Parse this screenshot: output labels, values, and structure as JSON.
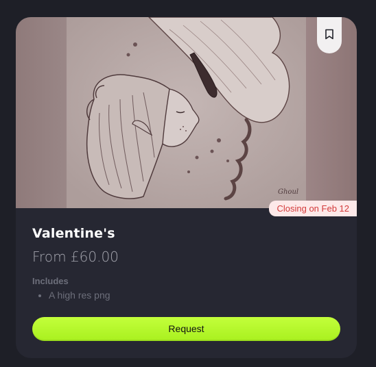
{
  "listing": {
    "title": "Valentine's",
    "price": "From £60.00",
    "includes_label": "Includes",
    "includes": [
      "A high res png"
    ],
    "badge": "Closing on Feb 12",
    "cta_label": "Request",
    "signature": "Ghoul"
  },
  "icons": {
    "bookmark": "bookmark-icon"
  },
  "colors": {
    "page_bg": "#1e1f27",
    "card_bg": "#262732",
    "accent": "#b6f72a",
    "badge_text": "#d33a3a",
    "badge_bg": "#fde9e9"
  }
}
